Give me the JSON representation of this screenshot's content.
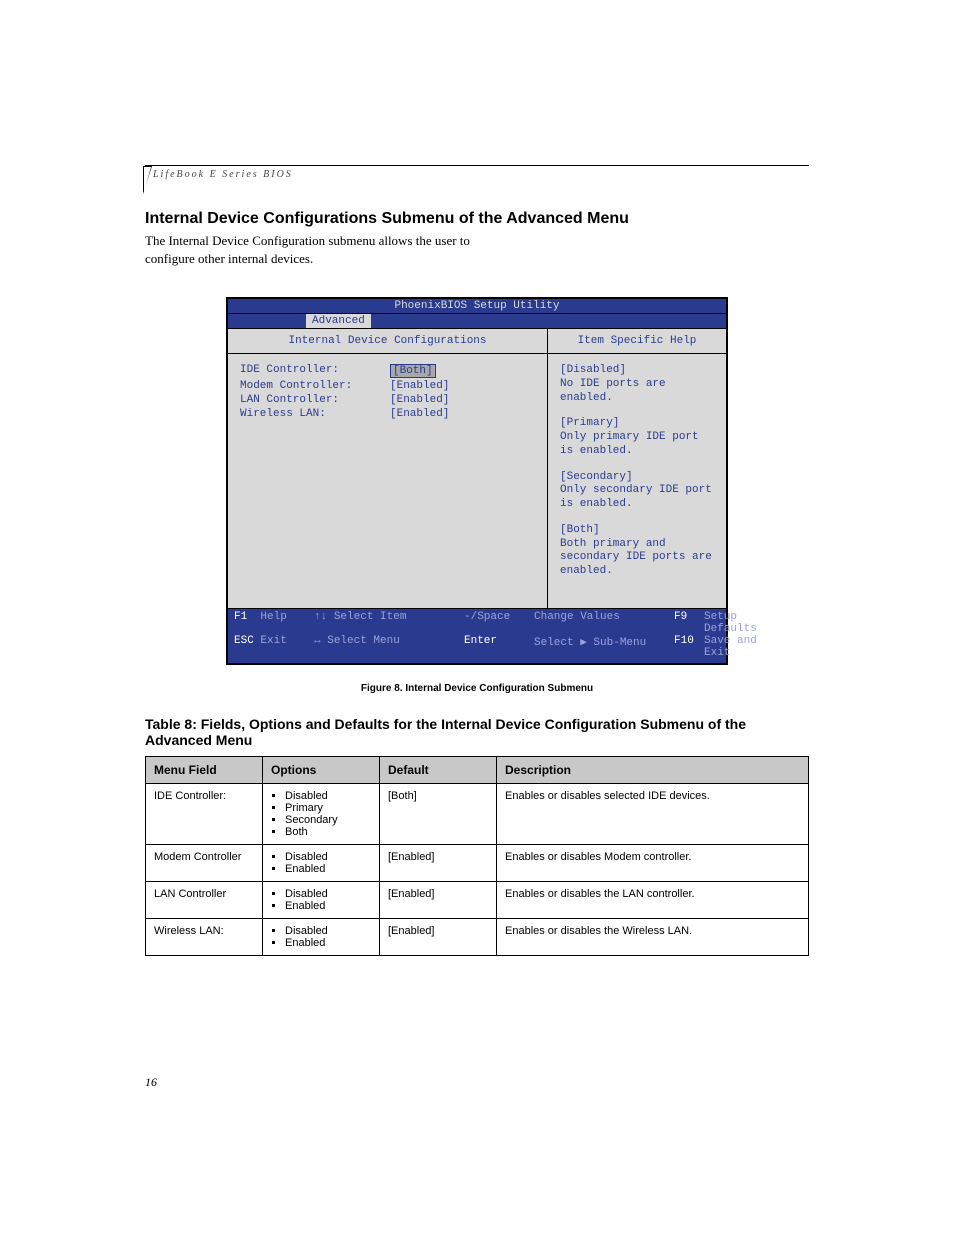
{
  "running_head": "LifeBook E Series BIOS",
  "section_title": "Internal Device Configurations Submenu of the Advanced Menu",
  "intro_text": "The Internal Device Configuration submenu allows the user to configure other internal devices.",
  "bios": {
    "title": "PhoenixBIOS Setup Utility",
    "active_tab": "Advanced",
    "left_pane_title": "Internal Device Configurations",
    "right_pane_title": "Item Specific Help",
    "fields": [
      {
        "label": "IDE Controller:",
        "value": "[Both]",
        "selected": true
      },
      {
        "label": "Modem Controller:",
        "value": "[Enabled]",
        "selected": false
      },
      {
        "label": "LAN Controller:",
        "value": "[Enabled]",
        "selected": false
      },
      {
        "label": "Wireless LAN:",
        "value": "[Enabled]",
        "selected": false
      }
    ],
    "help": [
      {
        "head": "[Disabled]",
        "body": "No IDE ports are enabled."
      },
      {
        "head": "[Primary]",
        "body": "Only primary IDE port is enabled."
      },
      {
        "head": "[Secondary]",
        "body": "Only secondary IDE port is enabled."
      },
      {
        "head": "[Both]",
        "body": "Both primary and secondary IDE ports are enabled."
      }
    ],
    "footer": {
      "f1": "F1",
      "f1_label": "Help",
      "nav1_sym": "↑↓",
      "nav1_label": "Select Item",
      "val_sym": "-/Space",
      "val_label": "Change Values",
      "f9": "F9",
      "f9_label": "Setup Defaults",
      "esc": "ESC",
      "esc_label": "Exit",
      "nav2_sym": "↔",
      "nav2_label": "Select Menu",
      "enter": "Enter",
      "enter_label": "Select ▶ Sub-Menu",
      "f10": "F10",
      "f10_label": "Save and Exit"
    }
  },
  "figure_caption": "Figure 8.  Internal Device Configuration Submenu",
  "table_title": "Table 8: Fields, Options and Defaults for the Internal Device Configuration Submenu of the Advanced Menu",
  "table": {
    "headers": [
      "Menu Field",
      "Options",
      "Default",
      "Description"
    ],
    "rows": [
      {
        "field": "IDE Controller:",
        "options": [
          "Disabled",
          "Primary",
          "Secondary",
          "Both"
        ],
        "default": "[Both]",
        "description": "Enables or disables selected IDE devices."
      },
      {
        "field": "Modem Controller",
        "options": [
          "Disabled",
          "Enabled"
        ],
        "default": "[Enabled]",
        "description": "Enables or disables Modem controller."
      },
      {
        "field": "LAN Controller",
        "options": [
          "Disabled",
          "Enabled"
        ],
        "default": "[Enabled]",
        "description": "Enables or disables the LAN controller."
      },
      {
        "field": "Wireless LAN:",
        "options": [
          "Disabled",
          "Enabled"
        ],
        "default": "[Enabled]",
        "description": "Enables or disables the Wireless LAN."
      }
    ]
  },
  "page_number": "16"
}
